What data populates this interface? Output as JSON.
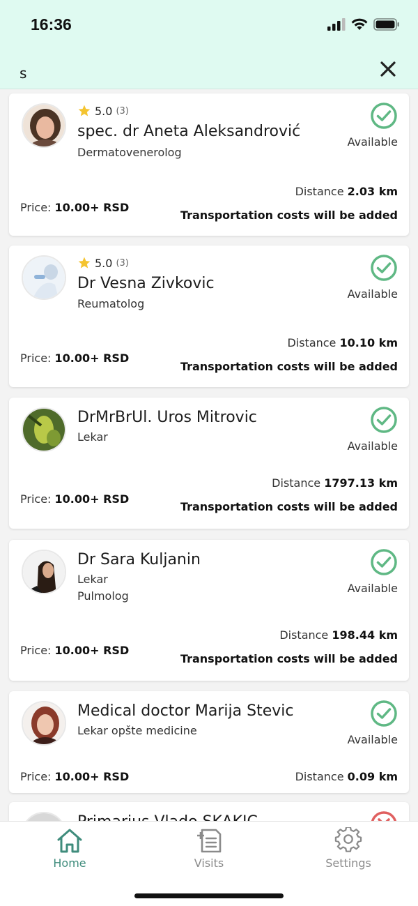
{
  "status_bar": {
    "time": "16:36"
  },
  "search": {
    "value": "s"
  },
  "colors": {
    "header_bg": "#dffaf1",
    "available_green": "#5fb884",
    "unavailable_red": "#e06060",
    "nav_active": "#3f8c7c",
    "nav_inactive": "#8a8a8a",
    "star": "#f4c430"
  },
  "doctors": [
    {
      "rating": "5.0",
      "rating_count": "(3)",
      "name": "spec. dr Aneta Aleksandrović",
      "specialties": [
        "Dermatovenerolog"
      ],
      "availability": "Available",
      "distance_label": "Distance",
      "distance_value": "2.03 km",
      "price_label": "Price:",
      "price_value": "10.00+ RSD",
      "transport_note": "Transportation costs will be added"
    },
    {
      "rating": "5.0",
      "rating_count": "(3)",
      "name": "Dr Vesna Zivkovic",
      "specialties": [
        "Reumatolog"
      ],
      "availability": "Available",
      "distance_label": "Distance",
      "distance_value": "10.10 km",
      "price_label": "Price:",
      "price_value": "10.00+ RSD",
      "transport_note": "Transportation costs will be added"
    },
    {
      "name": "DrMrBrUl. Uros Mitrovic",
      "specialties": [
        "Lekar"
      ],
      "availability": "Available",
      "distance_label": "Distance",
      "distance_value": "1797.13 km",
      "price_label": "Price:",
      "price_value": "10.00+ RSD",
      "transport_note": "Transportation costs will be added"
    },
    {
      "name": "Dr Sara Kuljanin",
      "specialties": [
        "Lekar",
        "Pulmolog"
      ],
      "availability": "Available",
      "distance_label": "Distance",
      "distance_value": "198.44 km",
      "price_label": "Price:",
      "price_value": "10.00+ RSD",
      "transport_note": "Transportation costs will be added"
    },
    {
      "name": "Medical doctor Marija Stevic",
      "specialties": [
        "Lekar opšte medicine"
      ],
      "availability": "Available",
      "distance_label": "Distance",
      "distance_value": "0.09 km",
      "price_label": "Price:",
      "price_value": "10.00+ RSD"
    },
    {
      "name": "Primarius Vlado SKAKIC"
    }
  ],
  "bottom_nav": {
    "items": [
      {
        "label": "Home",
        "icon": "home-icon",
        "active": true
      },
      {
        "label": "Visits",
        "icon": "visits-icon",
        "active": false
      },
      {
        "label": "Settings",
        "icon": "gear-icon",
        "active": false
      }
    ]
  }
}
